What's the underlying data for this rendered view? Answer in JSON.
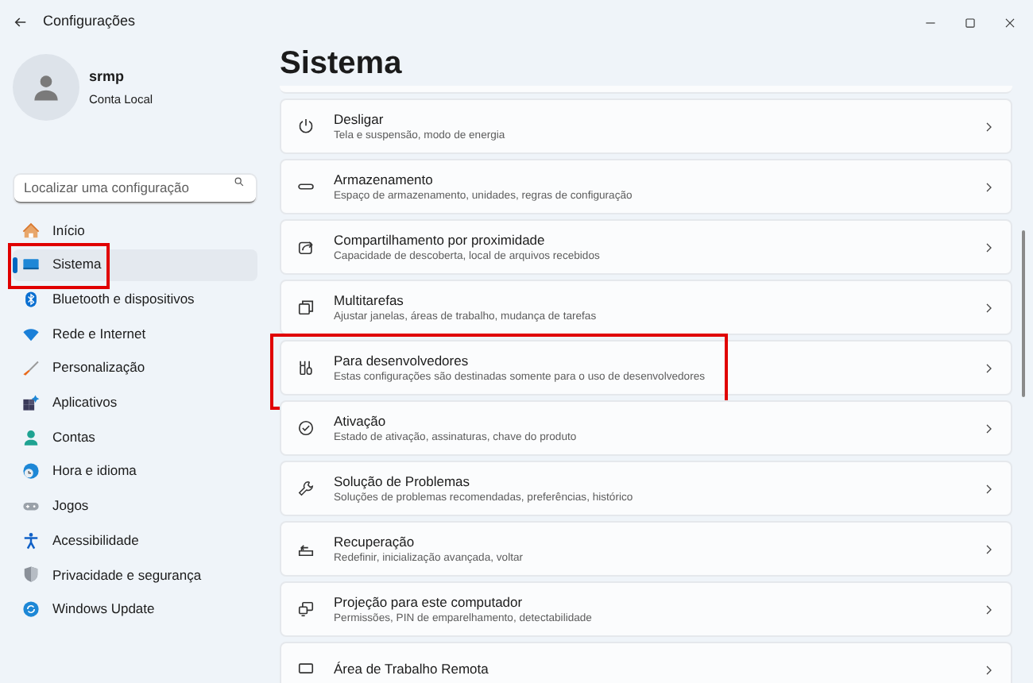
{
  "window": {
    "title": "Configurações"
  },
  "account": {
    "name": "srmp",
    "type": "Conta Local"
  },
  "search": {
    "placeholder": "Localizar uma configuração"
  },
  "sidebar": {
    "items": [
      {
        "label": "Início",
        "selected": false,
        "highlighted": false
      },
      {
        "label": "Sistema",
        "selected": true,
        "highlighted": true
      },
      {
        "label": "Bluetooth e dispositivos",
        "selected": false,
        "highlighted": false
      },
      {
        "label": "Rede e Internet",
        "selected": false,
        "highlighted": false
      },
      {
        "label": "Personalização",
        "selected": false,
        "highlighted": false
      },
      {
        "label": "Aplicativos",
        "selected": false,
        "highlighted": false
      },
      {
        "label": "Contas",
        "selected": false,
        "highlighted": false
      },
      {
        "label": "Hora e idioma",
        "selected": false,
        "highlighted": false
      },
      {
        "label": "Jogos",
        "selected": false,
        "highlighted": false
      },
      {
        "label": "Acessibilidade",
        "selected": false,
        "highlighted": false
      },
      {
        "label": "Privacidade e segurança",
        "selected": false,
        "highlighted": false
      },
      {
        "label": "Windows Update",
        "selected": false,
        "highlighted": false
      }
    ]
  },
  "page": {
    "title": "Sistema"
  },
  "cards": [
    {
      "title": "Desligar",
      "subtitle": "Tela e suspensão, modo de energia",
      "highlighted": false
    },
    {
      "title": "Armazenamento",
      "subtitle": "Espaço de armazenamento, unidades, regras de configuração",
      "highlighted": false
    },
    {
      "title": "Compartilhamento por proximidade",
      "subtitle": "Capacidade de descoberta, local de arquivos recebidos",
      "highlighted": false
    },
    {
      "title": "Multitarefas",
      "subtitle": "Ajustar janelas, áreas de trabalho, mudança de tarefas",
      "highlighted": false
    },
    {
      "title": "Para desenvolvedores",
      "subtitle": "Estas configurações são destinadas somente para o uso de desenvolvedores",
      "highlighted": true
    },
    {
      "title": "Ativação",
      "subtitle": "Estado de ativação, assinaturas, chave do produto",
      "highlighted": false
    },
    {
      "title": "Solução de Problemas",
      "subtitle": "Soluções de problemas recomendadas, preferências, histórico",
      "highlighted": false
    },
    {
      "title": "Recuperação",
      "subtitle": "Redefinir, inicialização avançada, voltar",
      "highlighted": false
    },
    {
      "title": "Projeção para este computador",
      "subtitle": "Permissões, PIN de emparelhamento, detectabilidade",
      "highlighted": false
    },
    {
      "title": "Área de Trabalho Remota",
      "highlighted": false
    }
  ]
}
